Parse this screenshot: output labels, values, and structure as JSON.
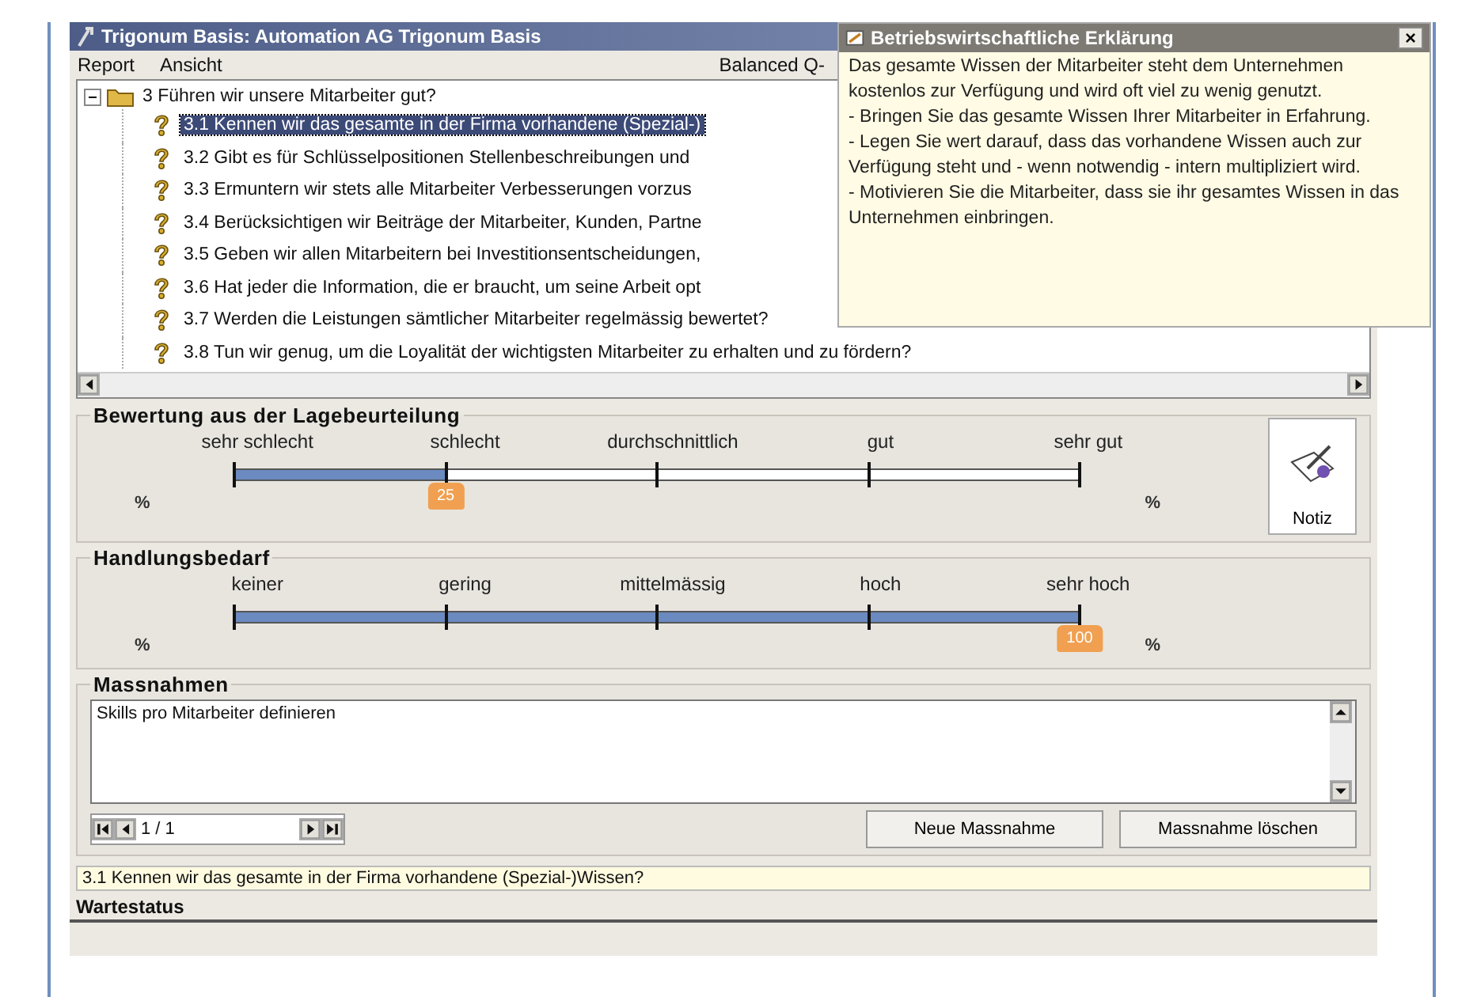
{
  "window": {
    "title": "Trigonum Basis: Automation AG Trigonum Basis"
  },
  "menu": [
    "Report",
    "Ansicht"
  ],
  "menu_right": "Balanced Q-",
  "tree": {
    "label": "3 Führen wir unsere Mitarbeiter gut?",
    "expanded": true,
    "children": [
      {
        "label": "3.1 Kennen wir das gesamte in der Firma vorhandene (Spezial-)",
        "selected": true
      },
      {
        "label": "3.2 Gibt es für Schlüsselpositionen Stellenbeschreibungen und",
        "selected": false
      },
      {
        "label": "3.3 Ermuntern wir stets alle Mitarbeiter Verbesserungen vorzus",
        "selected": false
      },
      {
        "label": "3.4 Berücksichtigen wir Beiträge der Mitarbeiter, Kunden, Partne",
        "selected": false
      },
      {
        "label": "3.5 Geben wir allen Mitarbeitern bei Investitionsentscheidungen,",
        "selected": false
      },
      {
        "label": "3.6 Hat jeder die Information, die er braucht, um seine Arbeit opt",
        "selected": false
      },
      {
        "label": "3.7 Werden die Leistungen sämtlicher Mitarbeiter regelmässig bewertet?",
        "selected": false
      },
      {
        "label": "3.8 Tun wir genug, um die Loyalität der wichtigsten Mitarbeiter zu erhalten und zu fördern?",
        "selected": false
      }
    ]
  },
  "popup": {
    "title": "Betriebswirtschaftliche Erklärung",
    "close": "×",
    "paragraphs": [
      "Das gesamte Wissen der Mitarbeiter steht dem Unternehmen kostenlos zur Verfügung und wird oft viel zu wenig genutzt.",
      "- Bringen Sie das gesamte Wissen Ihrer Mitarbeiter in Erfahrung.",
      "- Legen Sie wert darauf, dass das vorhandene Wissen auch zur Verfügung steht und - wenn notwendig - intern multipliziert wird.",
      "- Motivieren Sie die Mitarbeiter, dass sie ihr gesamtes Wissen in das Unternehmen einbringen."
    ]
  },
  "scales": [
    {
      "title": "Bewertung aus der Lagebeurteilung",
      "labels": [
        "sehr schlecht",
        "schlecht",
        "durchschnittlich",
        "gut",
        "sehr gut"
      ],
      "level": 0.25,
      "value": "25",
      "left_unit": "%",
      "right_unit": "%"
    },
    {
      "title": "Handlungsbedarf",
      "labels": [
        "keiner",
        "gering",
        "mittelmässig",
        "hoch",
        "sehr hoch"
      ],
      "level": 1,
      "value": "100",
      "left_unit": "%",
      "right_unit": "%"
    }
  ],
  "note_button": "Notiz",
  "measures": {
    "title": "Massnahmen",
    "text": "Skills pro Mitarbeiter definieren",
    "position": "1 / 1",
    "buttons": [
      "Neue Massnahme",
      "Massnahme löschen"
    ]
  },
  "current_question": "3.1 Kennen wir das gesamte in der Firma vorhandene (Spezial-)Wissen?",
  "status": "Wartestatus"
}
